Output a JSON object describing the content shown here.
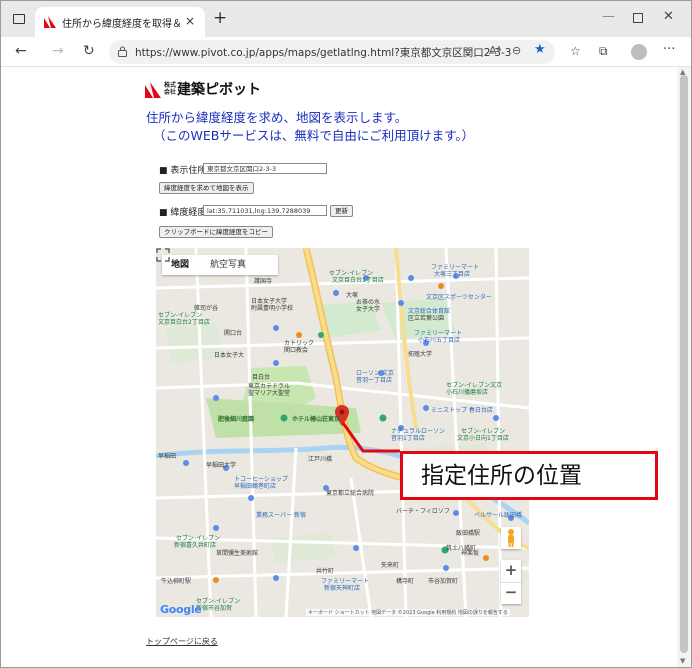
{
  "browser": {
    "tab_title": "住所から緯度経度を取得＆地図表",
    "tab_close": "×",
    "new_tab": "+",
    "url": "https://www.pivot.co.jp/apps/maps/getlatlng.html?東京都文京区関口2-3-3",
    "reader_icon": "Aᴬ",
    "zoom_icon": "⊖",
    "star_icon": "★",
    "favorites_icon": "☆",
    "collections_icon": "⧉",
    "more_icon": "···",
    "minimize_icon": "—",
    "close_icon": "✕",
    "back_icon": "←",
    "forward_icon": "→",
    "refresh_icon": "↻"
  },
  "page": {
    "company_kabu": "株式会社",
    "company_name": "建築ピボット",
    "intro_line1": "住所から緯度経度を求め、地図を表示します。",
    "intro_line2": "（このWEBサービスは、無料で自由にご利用頂けます。）",
    "address_label": "■ 表示住所",
    "address_value": "東京都文京区関口2-3-3",
    "show_map_button": "緯度経度を求めて地図を表示",
    "latlng_label": "■ 緯度経度",
    "latlng_value": "lat:35.711031,lng:139.7288039",
    "update_button": "更新",
    "copy_button": "クリップボードに緯度経度をコピー",
    "back_link": "トップページに戻る"
  },
  "map": {
    "tab_map": "地図",
    "tab_satellite": "航空写真",
    "google_logo": "Google",
    "attribution": "キーボード ショートカット  地図データ ©2023 Google  利用規約  地図の誤りを報告する",
    "zoom_in": "+",
    "zoom_out": "−",
    "labels": [
      {
        "text": "セブン-イレブン",
        "cls": "green"
      },
      {
        "text": "文京目白台1丁目店",
        "cls": "green"
      },
      {
        "text": "ファミリーマート",
        "cls": "blue"
      },
      {
        "text": "大塚三丁目店",
        "cls": "blue"
      },
      {
        "text": "護国寺",
        "cls": ""
      },
      {
        "text": "雑司が谷",
        "cls": ""
      },
      {
        "text": "日本女子大学",
        "cls": ""
      },
      {
        "text": "附属豊明小学校",
        "cls": ""
      },
      {
        "text": "大塚",
        "cls": ""
      },
      {
        "text": "お茶の水",
        "cls": ""
      },
      {
        "text": "女子大学",
        "cls": ""
      },
      {
        "text": "文京総合体育館",
        "cls": "blue"
      },
      {
        "text": "文京区スポーツセンター",
        "cls": "blue"
      },
      {
        "text": "区立若葉公園",
        "cls": ""
      },
      {
        "text": "セブン-イレブン",
        "cls": "green"
      },
      {
        "text": "文京目白台2丁目店",
        "cls": "green"
      },
      {
        "text": "関口台",
        "cls": ""
      },
      {
        "text": "日本女子大",
        "cls": ""
      },
      {
        "text": "カトリック",
        "cls": ""
      },
      {
        "text": "関口教会",
        "cls": ""
      },
      {
        "text": "ファミリーマート",
        "cls": "blue"
      },
      {
        "text": "小石川五丁目店",
        "cls": "blue"
      },
      {
        "text": "拓殖大学",
        "cls": ""
      },
      {
        "text": "目白台",
        "cls": ""
      },
      {
        "text": "東京カテドラル",
        "cls": ""
      },
      {
        "text": "聖マリア大聖堂",
        "cls": ""
      },
      {
        "text": "ローソン 文京",
        "cls": "blue"
      },
      {
        "text": "音羽一丁目店",
        "cls": "blue"
      },
      {
        "text": "セブン-イレブン文京",
        "cls": "green"
      },
      {
        "text": "小石川播磨坂店",
        "cls": "green"
      },
      {
        "text": "ミニストップ 春日台店",
        "cls": "blue"
      },
      {
        "text": "肥後細川庭園",
        "cls": "park"
      },
      {
        "text": "ホテル椿山荘東京",
        "cls": "park"
      },
      {
        "text": "ナチュラルローソン",
        "cls": "blue"
      },
      {
        "text": "音羽1丁目店",
        "cls": "blue"
      },
      {
        "text": "セブン-イレブン",
        "cls": "green"
      },
      {
        "text": "文京小日向1丁目店",
        "cls": "green"
      },
      {
        "text": "早稲田",
        "cls": ""
      },
      {
        "text": "早稲田大学",
        "cls": ""
      },
      {
        "text": "江戸川橋",
        "cls": ""
      },
      {
        "text": "トコーヒーショップ",
        "cls": "blue"
      },
      {
        "text": "早稲田鶴巻町店",
        "cls": "blue"
      },
      {
        "text": "東京都立総合病院",
        "cls": ""
      },
      {
        "text": "業務スーパー 新宿",
        "cls": "blue"
      },
      {
        "text": "バーチ・フィロソフ",
        "cls": ""
      },
      {
        "text": "ベルサール飯田橋",
        "cls": "blue"
      },
      {
        "text": "セブン-イレブン",
        "cls": "green"
      },
      {
        "text": "新宿喜久井町店",
        "cls": "green"
      },
      {
        "text": "筑土八幡町",
        "cls": ""
      },
      {
        "text": "飯田橋駅",
        "cls": ""
      },
      {
        "text": "草間彌生美術館",
        "cls": ""
      },
      {
        "text": "矢来町",
        "cls": ""
      },
      {
        "text": "井竹町",
        "cls": ""
      },
      {
        "text": "ファミリーマート",
        "cls": "blue"
      },
      {
        "text": "新宿天神町店",
        "cls": "blue"
      },
      {
        "text": "構寺町",
        "cls": ""
      },
      {
        "text": "市谷加賀町",
        "cls": ""
      },
      {
        "text": "神楽坂",
        "cls": ""
      },
      {
        "text": "牛込柳町駅",
        "cls": ""
      },
      {
        "text": "セブン-イレブン",
        "cls": "green"
      },
      {
        "text": "新宿市谷加賀",
        "cls": "green"
      }
    ]
  },
  "callout": {
    "text": "指定住所の位置"
  },
  "colors": {
    "intro_blue": "#1a2fbf",
    "callout_red": "#e30613",
    "marker_red": "#d93025",
    "park_green": "#c8e6b0",
    "road_yellow": "#f7d57a"
  }
}
